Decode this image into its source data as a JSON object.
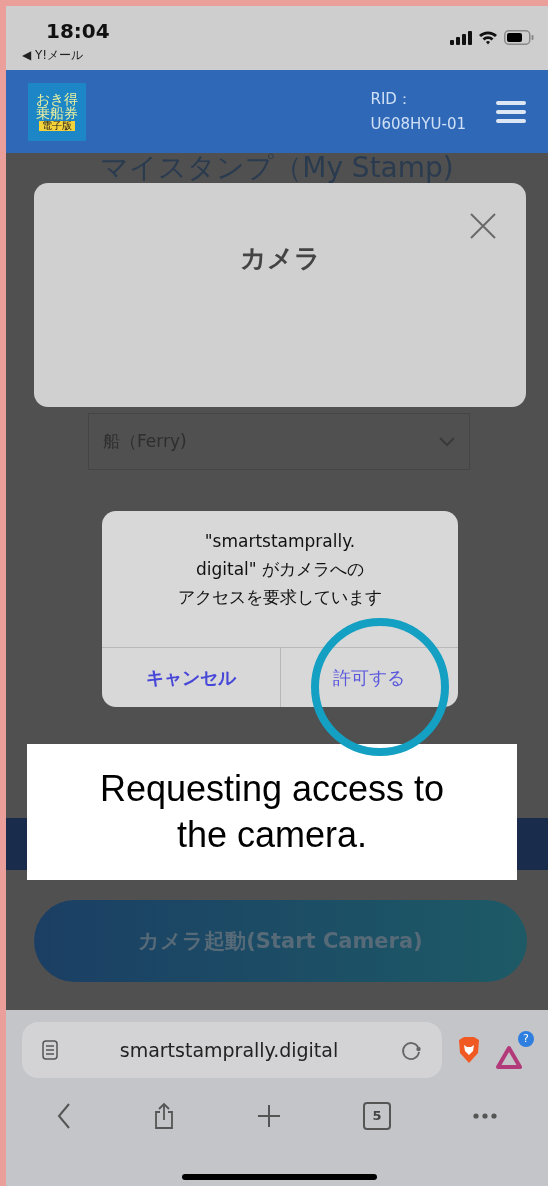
{
  "status_bar": {
    "time": "18:04",
    "back_link": "◀ Y!メール"
  },
  "header": {
    "logo_lines": [
      "おき得",
      "乗船券",
      "電子版"
    ],
    "rid_label": "RID：",
    "rid_value": "U608HYU-01"
  },
  "page": {
    "title": "マイスタンプ（My Stamp)",
    "camera_modal": {
      "title": "カメラ"
    },
    "transport_select": {
      "value": "船（Ferry)"
    },
    "start_button": "カメラ起動(Start Camera)"
  },
  "alert": {
    "message_lines": [
      "\"smartstamprally.",
      "digital\" がカメラへの",
      "アクセスを要求しています"
    ],
    "buttons": [
      {
        "label": "キャンセル",
        "kind": "cancel"
      },
      {
        "label": "許可する",
        "kind": "default"
      }
    ]
  },
  "annotation": {
    "caption": "Requesting access to\nthe camera."
  },
  "browser": {
    "url": "smartstamprally.digital",
    "extension_badge": "?",
    "tab_count": "5"
  }
}
